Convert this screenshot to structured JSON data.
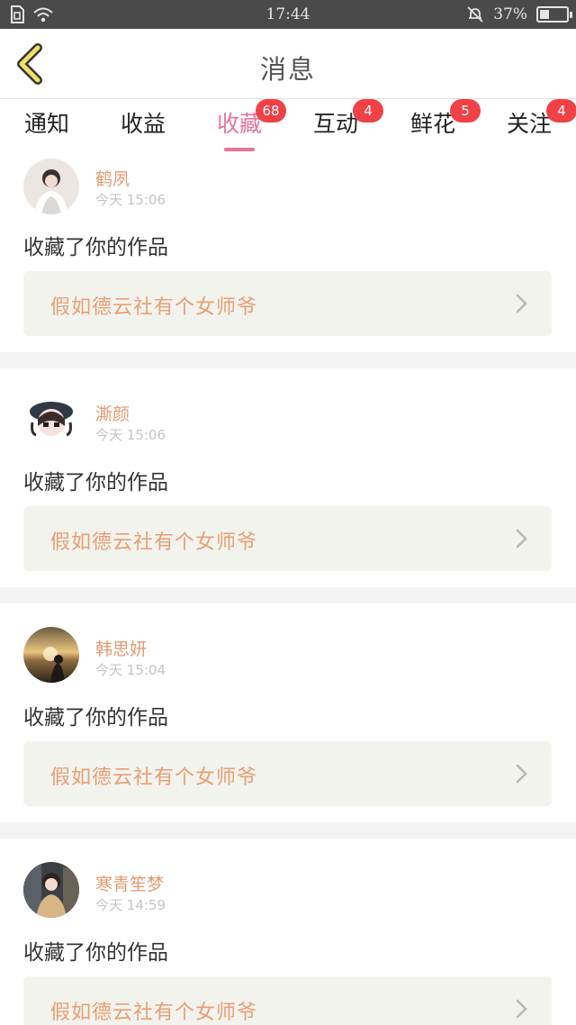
{
  "status_bar": {
    "time": "17:44",
    "battery": "37%",
    "battery_level": 0.37,
    "icons": [
      "sim-icon",
      "wifi-icon",
      "mute-bell-icon",
      "battery-icon"
    ]
  },
  "header": {
    "title": "消息",
    "back_icon": "chevron-left-icon"
  },
  "colors": {
    "accent_pink": "#e6739f",
    "badge_red": "#f04147",
    "name_orange": "#e29b72",
    "work_title": "#e79f73"
  },
  "tabs": [
    {
      "label": "通知",
      "badge": ""
    },
    {
      "label": "收益",
      "badge": ""
    },
    {
      "label": "收藏",
      "badge": "68",
      "active": true
    },
    {
      "label": "互动",
      "badge": "4"
    },
    {
      "label": "鲜花",
      "badge": "5"
    },
    {
      "label": "关注",
      "badge": "4"
    }
  ],
  "messages": [
    {
      "user": "鹤夙",
      "time": "今天 15:06",
      "action": "收藏了你的作品",
      "work": "假如德云社有个女师爷"
    },
    {
      "user": "澌颜",
      "time": "今天 15:06",
      "action": "收藏了你的作品",
      "work": "假如德云社有个女师爷"
    },
    {
      "user": "韩思妍",
      "time": "今天 15:04",
      "action": "收藏了你的作品",
      "work": "假如德云社有个女师爷"
    },
    {
      "user": "寒青笙梦",
      "time": "今天 14:59",
      "action": "收藏了你的作品",
      "work": "假如德云社有个女师爷"
    }
  ]
}
